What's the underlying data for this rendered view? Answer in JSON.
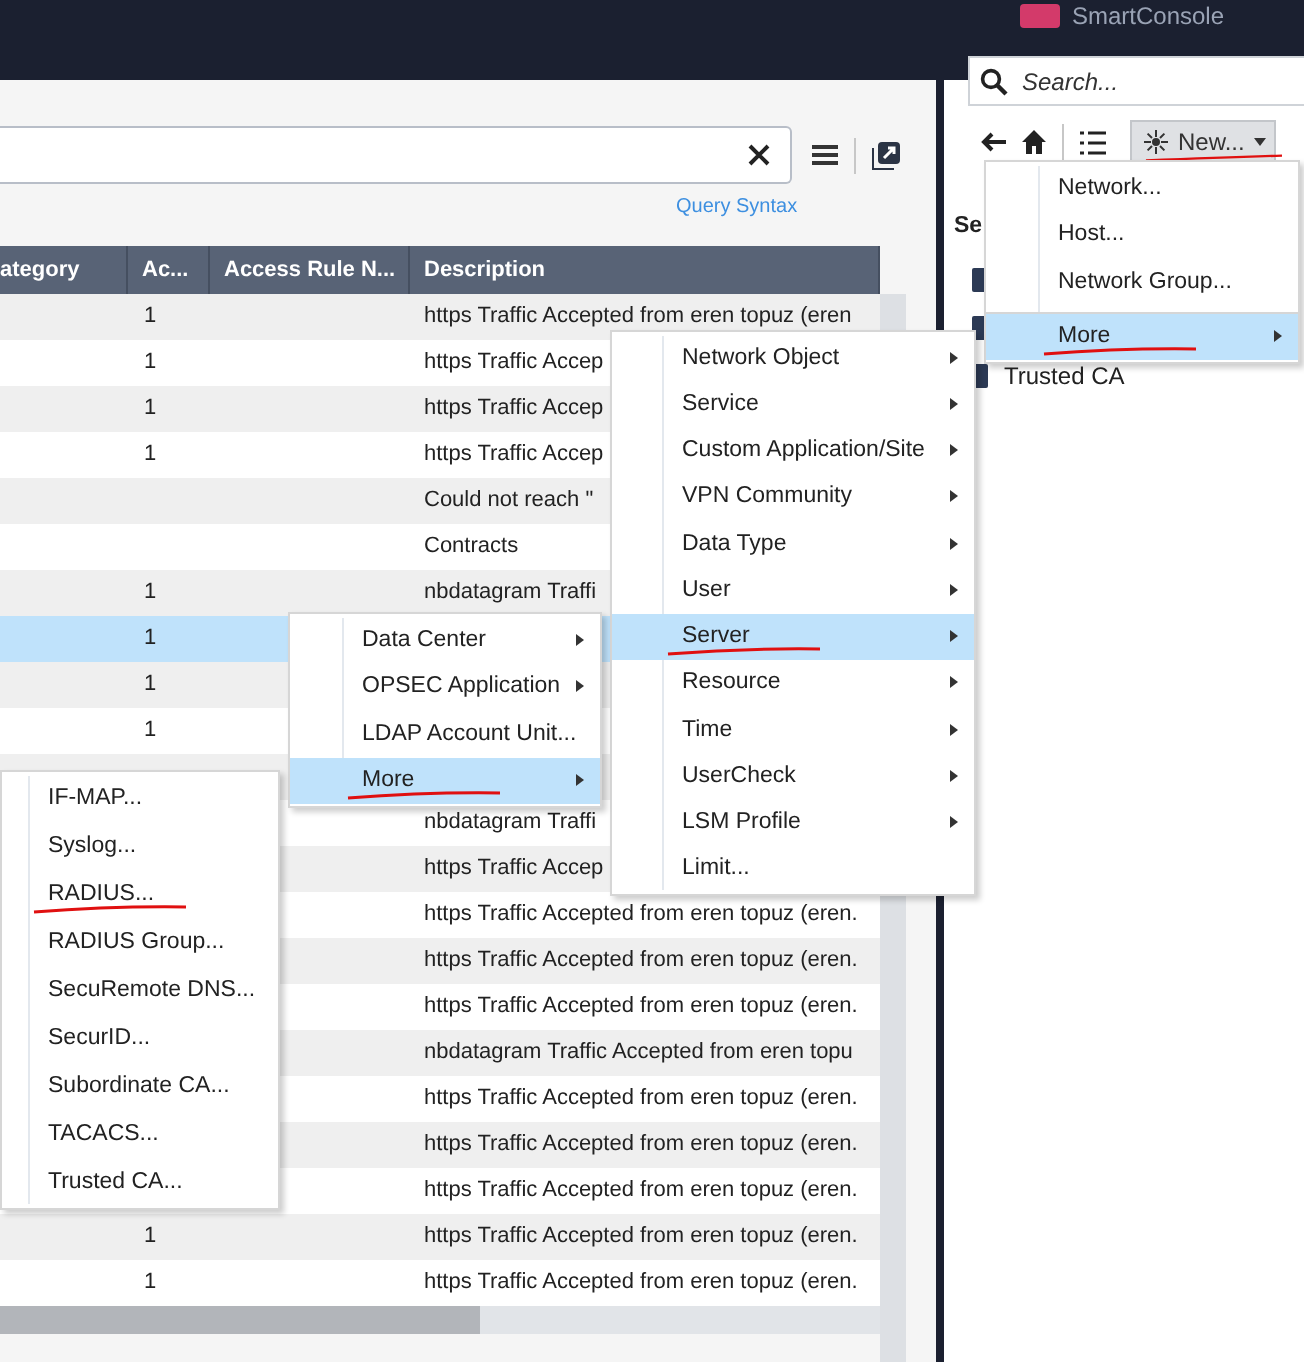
{
  "app": {
    "title": "SmartConsole"
  },
  "query": {
    "link": "Query Syntax"
  },
  "table": {
    "columns": [
      "ategory",
      "Ac...",
      "Access Rule N...",
      "Description"
    ],
    "rows": [
      {
        "ac": "1",
        "description": "https Traffic Accepted from eren topuz (eren",
        "selected": false
      },
      {
        "ac": "1",
        "description": "https Traffic Accep",
        "selected": false
      },
      {
        "ac": "1",
        "description": "https Traffic Accep",
        "selected": false
      },
      {
        "ac": "1",
        "description": "https Traffic Accep",
        "selected": false
      },
      {
        "description": "Could not reach \"",
        "selected": false
      },
      {
        "description": "Contracts",
        "selected": false
      },
      {
        "ac": "1",
        "description": "nbdatagram Traffi",
        "selected": false
      },
      {
        "ac": "1",
        "selected": true
      },
      {
        "ac": "1",
        "selected": false
      },
      {
        "ac": "1",
        "selected": false
      },
      {
        "selected": false
      },
      {
        "description": "nbdatagram Traffi",
        "selected": false
      },
      {
        "description": "https Traffic Accep",
        "selected": false
      },
      {
        "description": "https Traffic Accepted from eren topuz (eren.",
        "selected": false
      },
      {
        "description": "https Traffic Accepted from eren topuz (eren.",
        "selected": false
      },
      {
        "description": "https Traffic Accepted from eren topuz (eren.",
        "selected": false
      },
      {
        "description": "nbdatagram Traffic Accepted from eren topu",
        "selected": false
      },
      {
        "description": "https Traffic Accepted from eren topuz (eren.",
        "selected": false
      },
      {
        "description": "https Traffic Accepted from eren topuz (eren.",
        "selected": false
      },
      {
        "description": "https Traffic Accepted from eren topuz (eren.",
        "selected": false
      },
      {
        "ac": "1",
        "description": "https Traffic Accepted from eren topuz (eren.",
        "selected": false
      },
      {
        "ac": "1",
        "description": "https Traffic Accepted from eren topuz (eren.",
        "selected": false
      }
    ]
  },
  "objects": {
    "search": {
      "placeholder": "Search..."
    },
    "new_button": {
      "label": "New...",
      "underlined": true
    },
    "section_label": "Se",
    "items": [
      {
        "label": "Trusted CA"
      }
    ]
  },
  "menus": [
    {
      "items": [
        {
          "label": "Network...",
          "submenu": false,
          "selected": false,
          "underlined": false,
          "separator_before": false
        },
        {
          "label": "Host...",
          "submenu": false,
          "selected": false,
          "underlined": false,
          "separator_before": false
        },
        {
          "label": "Network Group...",
          "submenu": false,
          "selected": false,
          "underlined": false,
          "separator_before": false
        },
        {
          "label": "More",
          "submenu": true,
          "selected": true,
          "underlined": true,
          "separator_before": true
        }
      ]
    },
    {
      "items": [
        {
          "label": "Network Object",
          "submenu": true,
          "selected": false,
          "underlined": false,
          "separator_before": false
        },
        {
          "label": "Service",
          "submenu": true,
          "selected": false,
          "underlined": false,
          "separator_before": false
        },
        {
          "label": "Custom Application/Site",
          "submenu": true,
          "selected": false,
          "underlined": false,
          "separator_before": false
        },
        {
          "label": "VPN Community",
          "submenu": true,
          "selected": false,
          "underlined": false,
          "separator_before": false
        },
        {
          "label": "Data Type",
          "submenu": true,
          "selected": false,
          "underlined": false,
          "separator_before": false
        },
        {
          "label": "User",
          "submenu": true,
          "selected": false,
          "underlined": false,
          "separator_before": false
        },
        {
          "label": "Server",
          "submenu": true,
          "selected": true,
          "underlined": true,
          "separator_before": false
        },
        {
          "label": "Resource",
          "submenu": true,
          "selected": false,
          "underlined": false,
          "separator_before": false
        },
        {
          "label": "Time",
          "submenu": true,
          "selected": false,
          "underlined": false,
          "separator_before": false
        },
        {
          "label": "UserCheck",
          "submenu": true,
          "selected": false,
          "underlined": false,
          "separator_before": false
        },
        {
          "label": "LSM Profile",
          "submenu": true,
          "selected": false,
          "underlined": false,
          "separator_before": false
        },
        {
          "label": "Limit...",
          "submenu": false,
          "selected": false,
          "underlined": false,
          "separator_before": false
        }
      ]
    },
    {
      "items": [
        {
          "label": "Data Center",
          "submenu": true,
          "selected": false,
          "underlined": false,
          "separator_before": false
        },
        {
          "label": "OPSEC Application",
          "submenu": true,
          "selected": false,
          "underlined": false,
          "separator_before": false
        },
        {
          "label": "LDAP Account Unit...",
          "submenu": false,
          "selected": false,
          "underlined": false,
          "separator_before": false
        },
        {
          "label": "More",
          "submenu": true,
          "selected": true,
          "underlined": true,
          "separator_before": false
        }
      ]
    },
    {
      "items": [
        {
          "label": "IF-MAP...",
          "submenu": false,
          "selected": false,
          "underlined": false,
          "separator_before": false
        },
        {
          "label": "Syslog...",
          "submenu": false,
          "selected": false,
          "underlined": false,
          "separator_before": false
        },
        {
          "label": "RADIUS...",
          "submenu": false,
          "selected": false,
          "underlined": true,
          "separator_before": false
        },
        {
          "label": "RADIUS Group...",
          "submenu": false,
          "selected": false,
          "underlined": false,
          "separator_before": false
        },
        {
          "label": "SecuRemote DNS...",
          "submenu": false,
          "selected": false,
          "underlined": false,
          "separator_before": false
        },
        {
          "label": "SecurID...",
          "submenu": false,
          "selected": false,
          "underlined": false,
          "separator_before": false
        },
        {
          "label": "Subordinate CA...",
          "submenu": false,
          "selected": false,
          "underlined": false,
          "separator_before": false
        },
        {
          "label": "TACACS...",
          "submenu": false,
          "selected": false,
          "underlined": false,
          "separator_before": false
        },
        {
          "label": "Trusted CA...",
          "submenu": false,
          "selected": false,
          "underlined": false,
          "separator_before": false
        }
      ]
    }
  ]
}
